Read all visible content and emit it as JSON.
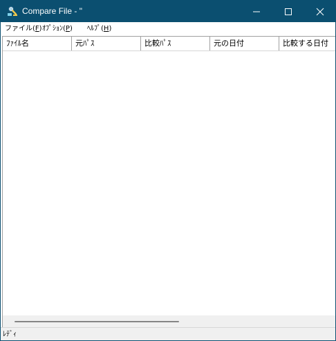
{
  "window": {
    "title": "Compare File - \"",
    "app_icon": "search-person-icon",
    "controls": {
      "minimize_icon": "minimize-icon",
      "maximize_icon": "maximize-icon",
      "close_icon": "close-icon"
    },
    "titlebar_color": "#0b4f70"
  },
  "menu": {
    "items": [
      {
        "label": "ファイル(",
        "key": "F",
        "suffix": ")"
      },
      {
        "label": "ｵﾌﾟｼｮﾝ(",
        "key": "P",
        "suffix": ")"
      },
      {
        "label": "ﾍﾙﾌﾟ(",
        "key": "H",
        "suffix": ")"
      }
    ]
  },
  "list": {
    "columns": [
      "ﾌｧｲﾙ名",
      "元ﾊﾟｽ",
      "比較ﾊﾟｽ",
      "元の日付",
      "比較する日付"
    ],
    "rows": []
  },
  "status": {
    "text": "ﾚﾃﾞｨ"
  }
}
